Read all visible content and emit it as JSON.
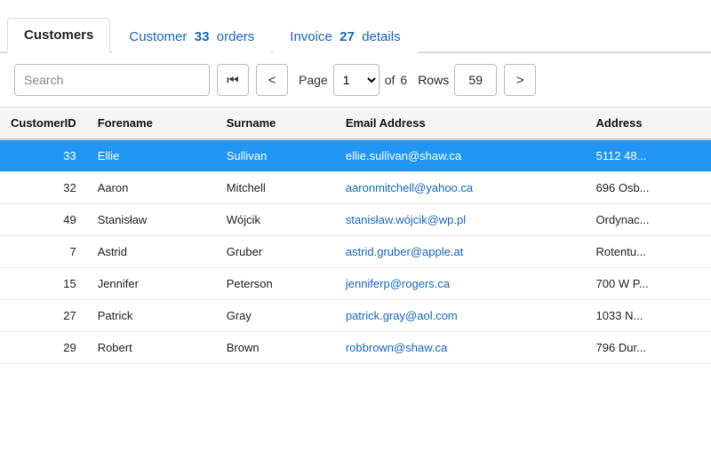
{
  "tabs": [
    {
      "id": "customers",
      "label": "Customers",
      "count": null,
      "active": true
    },
    {
      "id": "orders",
      "label": "Customer",
      "count": "33",
      "suffix": "orders",
      "active": false
    },
    {
      "id": "invoices",
      "label": "Invoice",
      "count": "27",
      "suffix": "details",
      "active": false
    }
  ],
  "toolbar": {
    "search_placeholder": "Search",
    "page_label": "Page",
    "current_page": "1",
    "total_pages": "6",
    "of_label": "of",
    "rows_label": "Rows",
    "rows_count": "59",
    "first_btn": "⏮",
    "prev_btn": "‹",
    "next_btn": "›"
  },
  "table": {
    "columns": [
      "CustomerID",
      "Forename",
      "Surname",
      "Email Address",
      "Address"
    ],
    "rows": [
      {
        "id": "33",
        "forename": "Ellie",
        "surname": "Sullivan",
        "email": "ellie.sullivan@shaw.ca",
        "address": "5112 48...",
        "selected": true
      },
      {
        "id": "32",
        "forename": "Aaron",
        "surname": "Mitchell",
        "email": "aaronmitchell@yahoo.ca",
        "address": "696 Osb...",
        "selected": false
      },
      {
        "id": "49",
        "forename": "Stanisław",
        "surname": "Wójcik",
        "email": "stanisław.wójcik@wp.pl",
        "address": "Ordynac...",
        "selected": false
      },
      {
        "id": "7",
        "forename": "Astrid",
        "surname": "Gruber",
        "email": "astrid.gruber@apple.at",
        "address": "Rotentu...",
        "selected": false
      },
      {
        "id": "15",
        "forename": "Jennifer",
        "surname": "Peterson",
        "email": "jenniferp@rogers.ca",
        "address": "700 W P...",
        "selected": false
      },
      {
        "id": "27",
        "forename": "Patrick",
        "surname": "Gray",
        "email": "patrick.gray@aol.com",
        "address": "1033 N...",
        "selected": false
      },
      {
        "id": "29",
        "forename": "Robert",
        "surname": "Brown",
        "email": "robbrown@shaw.ca",
        "address": "796 Dur...",
        "selected": false
      }
    ]
  }
}
